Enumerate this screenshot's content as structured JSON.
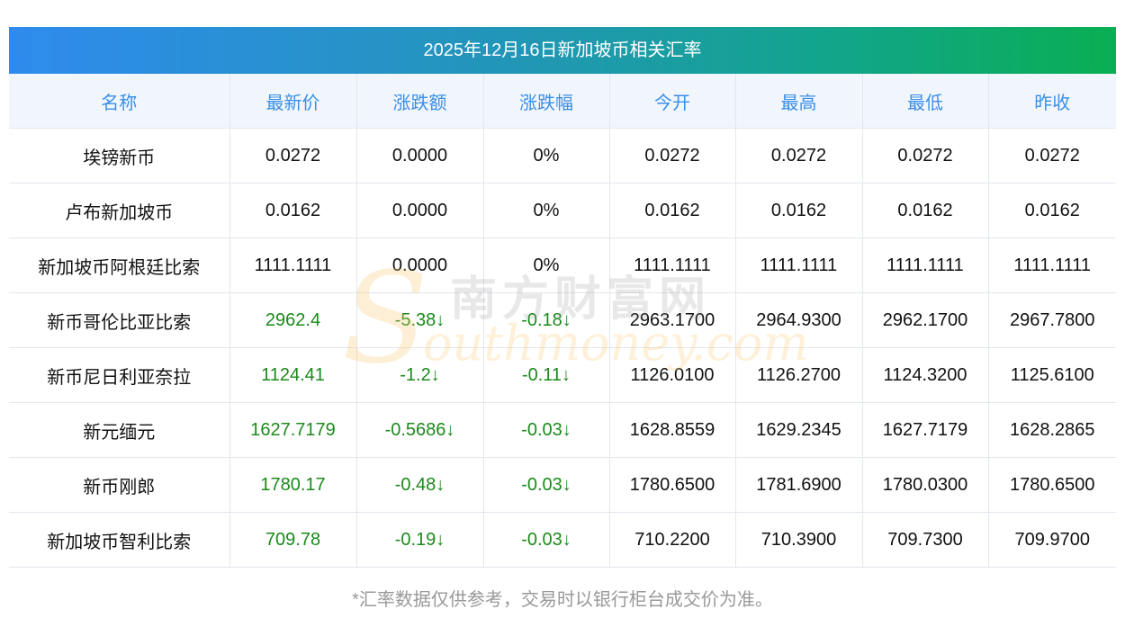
{
  "title": "2025年12月16日新加坡币相关汇率",
  "columns": [
    "名称",
    "最新价",
    "涨跌额",
    "涨跌幅",
    "今开",
    "最高",
    "最低",
    "昨收"
  ],
  "rows": [
    {
      "name": "埃镑新币",
      "latest": "0.0272",
      "change": "0.0000",
      "pct": "0%",
      "open": "0.0272",
      "high": "0.0272",
      "low": "0.0272",
      "prev": "0.0272",
      "trend": "flat"
    },
    {
      "name": "卢布新加坡币",
      "latest": "0.0162",
      "change": "0.0000",
      "pct": "0%",
      "open": "0.0162",
      "high": "0.0162",
      "low": "0.0162",
      "prev": "0.0162",
      "trend": "flat"
    },
    {
      "name": "新加坡币阿根廷比索",
      "latest": "1111.1111",
      "change": "0.0000",
      "pct": "0%",
      "open": "1111.1111",
      "high": "1111.1111",
      "low": "1111.1111",
      "prev": "1111.1111",
      "trend": "flat"
    },
    {
      "name": "新币哥伦比亚比索",
      "latest": "2962.4",
      "change": "-5.38↓",
      "pct": "-0.18↓",
      "open": "2963.1700",
      "high": "2964.9300",
      "low": "2962.1700",
      "prev": "2967.7800",
      "trend": "down"
    },
    {
      "name": "新币尼日利亚奈拉",
      "latest": "1124.41",
      "change": "-1.2↓",
      "pct": "-0.11↓",
      "open": "1126.0100",
      "high": "1126.2700",
      "low": "1124.3200",
      "prev": "1125.6100",
      "trend": "down"
    },
    {
      "name": "新元缅元",
      "latest": "1627.7179",
      "change": "-0.5686↓",
      "pct": "-0.03↓",
      "open": "1628.8559",
      "high": "1629.2345",
      "low": "1627.7179",
      "prev": "1628.2865",
      "trend": "down"
    },
    {
      "name": "新币刚郎",
      "latest": "1780.17",
      "change": "-0.48↓",
      "pct": "-0.03↓",
      "open": "1780.6500",
      "high": "1781.6900",
      "low": "1780.0300",
      "prev": "1780.6500",
      "trend": "down"
    },
    {
      "name": "新加坡币智利比索",
      "latest": "709.78",
      "change": "-0.19↓",
      "pct": "-0.03↓",
      "open": "710.2200",
      "high": "710.3900",
      "low": "709.7300",
      "prev": "709.9700",
      "trend": "down"
    }
  ],
  "watermark": {
    "cn": "南方财富网",
    "en": "outhmoney.com",
    "s": "S"
  },
  "footer": "*汇率数据仅供参考，交易时以银行柜台成交价为准。",
  "colors": {
    "header_text": "#3a8ee6",
    "down": "#1b8a1b",
    "header_bg": "#f1f6fd"
  }
}
